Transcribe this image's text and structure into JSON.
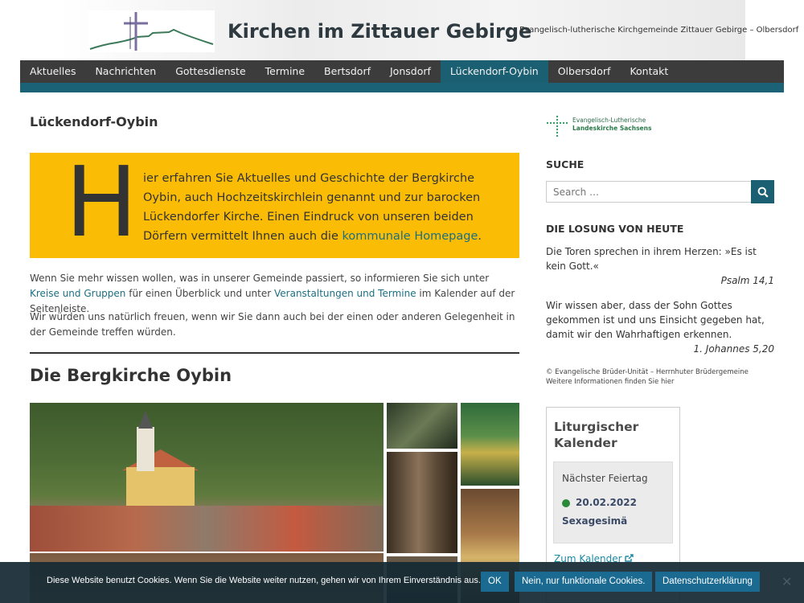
{
  "header": {
    "title": "Kirchen im Zittauer Gebirge",
    "description": "Evangelisch-lutherische Kirchgemeinde Zittauer Gebirge – Olbersdorf"
  },
  "nav": {
    "items": [
      "Aktuelles",
      "Nachrichten",
      "Gottesdienste",
      "Termine",
      "Bertsdorf",
      "Jonsdorf",
      "Lückendorf-Oybin",
      "Olbersdorf",
      "Kontakt"
    ],
    "active": "Lückendorf-Oybin"
  },
  "main": {
    "page_title": "Lückendorf-Oybin",
    "intro": {
      "dropcap": "H",
      "text": "ier erfahren Sie Aktuelles und Geschichte der Bergkirche Oybin, auch Hochzeitskirchlein genannt und zur barocken Lückendorfer Kirche. Einen Eindruck von unseren beiden Dörfern vermittelt Ihnen auch die ",
      "link": "kommunale Homepage",
      "end": "."
    },
    "para1": {
      "a": "Wenn Sie mehr wissen wollen, was in unserer Gemeinde passiert, so informieren Sie sich unter ",
      "link1": "Kreise und Gruppen",
      "b": " für einen Überblick und unter ",
      "link2": "Veranstaltungen und Termine",
      "c": " im Kalender auf der Seitenleiste."
    },
    "para2": "Wir würden uns natürlich freuen, wenn wir Sie dann auch bei der einen oder anderen Gelegenheit in der Gemeinde treffen würden.",
    "section_title": "Die Bergkirche Oybin"
  },
  "sidebar": {
    "logo": {
      "line1": "Evangelisch-Lutherische",
      "line2": "Landeskirche Sachsens"
    },
    "search": {
      "title": "SUCHE",
      "placeholder": "Search …"
    },
    "losung": {
      "title": "DIE LOSUNG VON HEUTE",
      "text1": "Die Toren sprechen in ihrem Herzen: »Es ist kein Gott.«",
      "ref1": "Psalm 14,1",
      "text2": "Wir wissen aber, dass der Sohn Gottes gekommen ist und uns Einsicht gegeben hat, damit wir den Wahrhaftigen erkennen.",
      "ref2": "1. Johannes 5,20",
      "footer1": "© Evangelische Brüder-Unität – Herrnhuter Brüdergemeine",
      "footer2": "Weitere Informationen finden Sie hier"
    },
    "kalender": {
      "title": "Liturgischer Kalender",
      "next_label": "Nächster Feiertag",
      "date": "20.02.2022",
      "name": "Sexagesimä",
      "link": "Zum Kalender"
    }
  },
  "cookie": {
    "text": "Diese Website benutzt Cookies. Wenn Sie die Website weiter nutzen, gehen wir von Ihrem Einverständnis aus.",
    "ok": "OK",
    "no": "Nein, nur funktionale Cookies.",
    "privacy": "Datenschutzerklärung",
    "close": "✕"
  },
  "colors": {
    "nav_bg": "#3c3c3c",
    "accent": "#1b5f73",
    "intro_bg": "#fbbc05",
    "link": "#1b6f80"
  }
}
